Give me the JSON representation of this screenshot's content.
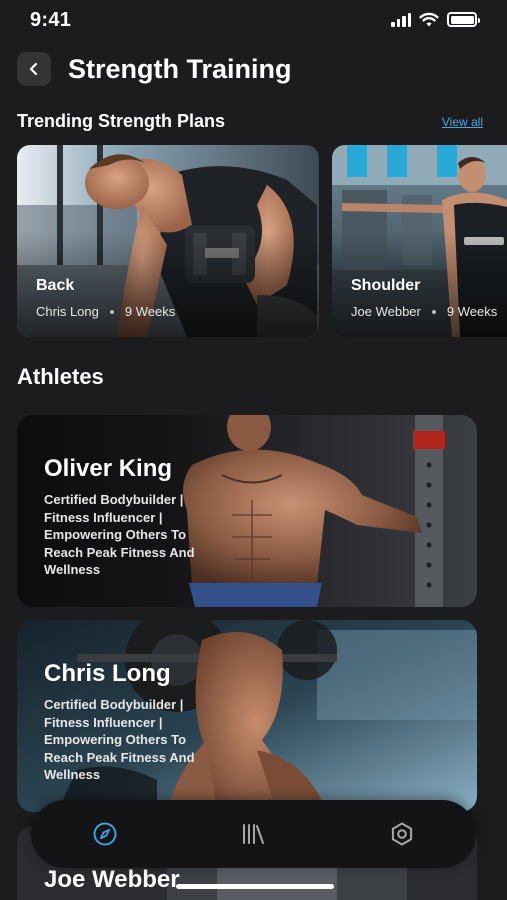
{
  "status": {
    "time": "9:41"
  },
  "header": {
    "title": "Strength Training"
  },
  "trending": {
    "title": "Trending Strength Plans",
    "view_all": "View all",
    "plans": [
      {
        "name": "Back",
        "coach": "Chris Long",
        "duration": "9 Weeks"
      },
      {
        "name": "Shoulder",
        "coach": "Joe Webber",
        "duration": "9 Weeks"
      }
    ]
  },
  "athletes": {
    "title": "Athletes",
    "items": [
      {
        "name": "Oliver King",
        "bio": "Certified Bodybuilder | Fitness Influencer | Empowering Others To Reach Peak Fitness And Wellness"
      },
      {
        "name": "Chris Long",
        "bio": "Certified Bodybuilder | Fitness Influencer | Empowering Others To Reach Peak Fitness And Wellness"
      },
      {
        "name": "Joe Webber",
        "bio": ""
      }
    ]
  },
  "nav": {
    "items": [
      "compass-icon",
      "library-icon",
      "settings-icon"
    ],
    "active_color": "#3ea0dc"
  },
  "colors": {
    "background": "#1c1c1e",
    "accent": "#4aa6e0"
  }
}
